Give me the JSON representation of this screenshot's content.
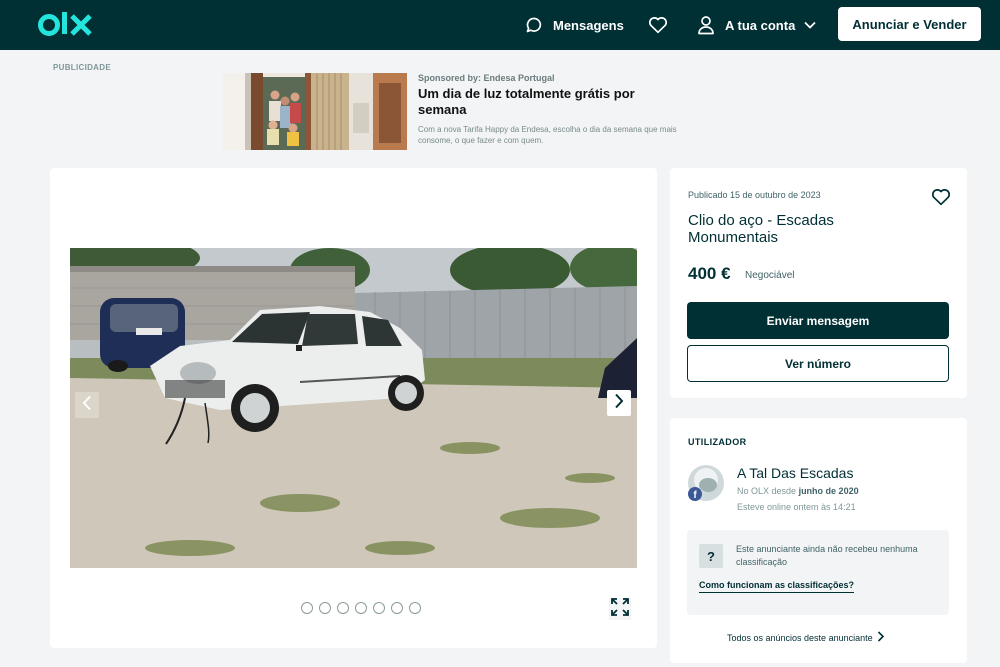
{
  "header": {
    "logo_text": "olx",
    "messages_label": "Mensagens",
    "account_label": "A tua conta",
    "sell_label": "Anunciar e Vender",
    "brand_color": "#23e5db",
    "bar_color": "#002f34"
  },
  "ad": {
    "label": "PUBLICIDADE",
    "sponsor": "Sponsored by: Endesa Portugal",
    "title": "Um dia de luz totalmente grátis por semana",
    "text": "Com a nova Tarifa Happy da Endesa, escolha o dia da semana que mais consome, o que fazer e com quem."
  },
  "gallery": {
    "image_alt": "Carro branco estacionado em terreno de gravilha",
    "dots_count": 7,
    "prev_icon": "chevron-left-icon",
    "next_icon": "chevron-right-icon",
    "expand_icon": "expand-icon"
  },
  "listing": {
    "published": "Publicado 15 de outubro de 2023",
    "title": "Clio do aço - Escadas Monumentais",
    "price": "400 €",
    "negotiable": "Negociável",
    "send_message": "Enviar mensagem",
    "show_number": "Ver número"
  },
  "user": {
    "section_label": "UTILIZADOR",
    "name": "A Tal Das Escadas",
    "since_prefix": "No OLX desde",
    "since_date": "junho de 2020",
    "online": "Esteve online ontem às 14:21",
    "rating_icon": "?",
    "rating_text": "Este anunciante ainda não recebeu nenhuma classificação",
    "rating_link": "Como funcionam as classificações?",
    "all_ads": "Todos os anúncios deste anunciante"
  }
}
